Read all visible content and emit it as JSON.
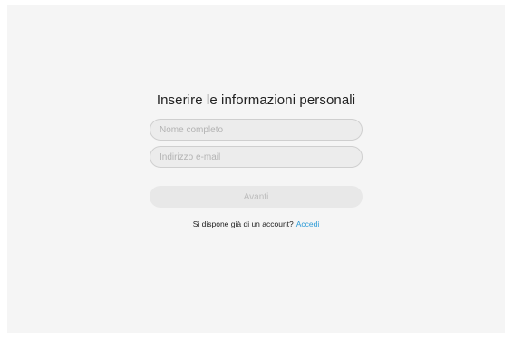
{
  "form": {
    "title": "Inserire le informazioni personali",
    "name_placeholder": "Nome completo",
    "name_value": "",
    "email_placeholder": "Indirizzo e-mail",
    "email_value": "",
    "submit_label": "Avanti",
    "account_prompt": "Si dispone già di un account?",
    "login_link": "Accedi"
  },
  "colors": {
    "background": "#f5f5f5",
    "field_fill": "#ececec",
    "button_disabled": "#e8e8e8",
    "link": "#2b9ad6"
  }
}
